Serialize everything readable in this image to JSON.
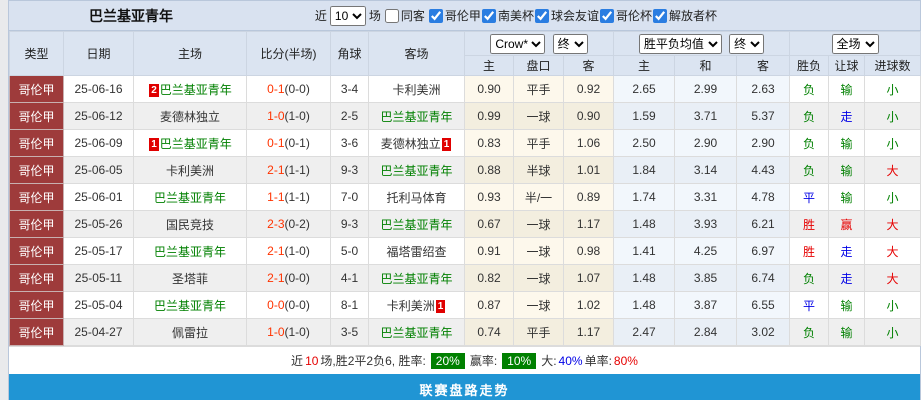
{
  "title": "巴兰基亚青年",
  "filters": {
    "recent_prefix": "近",
    "recent_value": "10",
    "recent_suffix": "场",
    "same_venue_label": "同客",
    "same_venue_checked": false,
    "competitions": [
      {
        "label": "哥伦甲",
        "checked": true
      },
      {
        "label": "南美杯",
        "checked": true
      },
      {
        "label": "球会友谊",
        "checked": true
      },
      {
        "label": "哥伦杯",
        "checked": true
      },
      {
        "label": "解放者杯",
        "checked": true
      }
    ]
  },
  "controls": {
    "bookmaker": "Crow*",
    "ah_time": "终",
    "europe": "胜平负均值",
    "eu_time": "终",
    "scope": "全场"
  },
  "table": {
    "headers": {
      "type": "类型",
      "date": "日期",
      "home": "主场",
      "score": "比分(半场)",
      "corner": "角球",
      "away": "客场",
      "ah_home": "主",
      "ah_line": "盘口",
      "ah_away": "客",
      "eu_home": "主",
      "eu_draw": "和",
      "eu_away": "客",
      "result": "胜负",
      "handicap": "让球",
      "goals": "进球数"
    },
    "rows": [
      {
        "type": "哥伦甲",
        "date": "25-06-16",
        "home": "巴兰基亚青年",
        "home_badge": "2",
        "home_self": true,
        "score": "0-1",
        "half": "(0-0)",
        "corner": "3-4",
        "away": "卡利美洲",
        "away_badge": null,
        "away_self": false,
        "ah_home": "0.90",
        "ah_line": "平手",
        "ah_away": "0.92",
        "eu_home": "2.65",
        "eu_draw": "2.99",
        "eu_away": "2.63",
        "result": "负",
        "handicap": "输",
        "goals": "小"
      },
      {
        "type": "哥伦甲",
        "date": "25-06-12",
        "home": "麦德林独立",
        "home_badge": null,
        "home_self": false,
        "score": "1-0",
        "half": "(1-0)",
        "corner": "2-5",
        "away": "巴兰基亚青年",
        "away_badge": null,
        "away_self": true,
        "ah_home": "0.99",
        "ah_line": "一球",
        "ah_away": "0.90",
        "eu_home": "1.59",
        "eu_draw": "3.71",
        "eu_away": "5.37",
        "result": "负",
        "handicap": "走",
        "goals": "小"
      },
      {
        "type": "哥伦甲",
        "date": "25-06-09",
        "home": "巴兰基亚青年",
        "home_badge": "1",
        "home_self": true,
        "score": "0-1",
        "half": "(0-1)",
        "corner": "3-6",
        "away": "麦德林独立",
        "away_badge": "1",
        "away_self": false,
        "ah_home": "0.83",
        "ah_line": "平手",
        "ah_away": "1.06",
        "eu_home": "2.50",
        "eu_draw": "2.90",
        "eu_away": "2.90",
        "result": "负",
        "handicap": "输",
        "goals": "小"
      },
      {
        "type": "哥伦甲",
        "date": "25-06-05",
        "home": "卡利美洲",
        "home_badge": null,
        "home_self": false,
        "score": "2-1",
        "half": "(1-1)",
        "corner": "9-3",
        "away": "巴兰基亚青年",
        "away_badge": null,
        "away_self": true,
        "ah_home": "0.88",
        "ah_line": "半球",
        "ah_away": "1.01",
        "eu_home": "1.84",
        "eu_draw": "3.14",
        "eu_away": "4.43",
        "result": "负",
        "handicap": "输",
        "goals": "大"
      },
      {
        "type": "哥伦甲",
        "date": "25-06-01",
        "home": "巴兰基亚青年",
        "home_badge": null,
        "home_self": true,
        "score": "1-1",
        "half": "(1-1)",
        "corner": "7-0",
        "away": "托利马体育",
        "away_badge": null,
        "away_self": false,
        "ah_home": "0.93",
        "ah_line": "半/一",
        "ah_away": "0.89",
        "eu_home": "1.74",
        "eu_draw": "3.31",
        "eu_away": "4.78",
        "result": "平",
        "handicap": "输",
        "goals": "小"
      },
      {
        "type": "哥伦甲",
        "date": "25-05-26",
        "home": "国民竞技",
        "home_badge": null,
        "home_self": false,
        "score": "2-3",
        "half": "(0-2)",
        "corner": "9-3",
        "away": "巴兰基亚青年",
        "away_badge": null,
        "away_self": true,
        "ah_home": "0.67",
        "ah_line": "一球",
        "ah_away": "1.17",
        "eu_home": "1.48",
        "eu_draw": "3.93",
        "eu_away": "6.21",
        "result": "胜",
        "handicap": "赢",
        "goals": "大"
      },
      {
        "type": "哥伦甲",
        "date": "25-05-17",
        "home": "巴兰基亚青年",
        "home_badge": null,
        "home_self": true,
        "score": "2-1",
        "half": "(1-0)",
        "corner": "5-0",
        "away": "福塔雷绍查",
        "away_badge": null,
        "away_self": false,
        "ah_home": "0.91",
        "ah_line": "一球",
        "ah_away": "0.98",
        "eu_home": "1.41",
        "eu_draw": "4.25",
        "eu_away": "6.97",
        "result": "胜",
        "handicap": "走",
        "goals": "大"
      },
      {
        "type": "哥伦甲",
        "date": "25-05-11",
        "home": "圣塔菲",
        "home_badge": null,
        "home_self": false,
        "score": "2-1",
        "half": "(0-0)",
        "corner": "4-1",
        "away": "巴兰基亚青年",
        "away_badge": null,
        "away_self": true,
        "ah_home": "0.82",
        "ah_line": "一球",
        "ah_away": "1.07",
        "eu_home": "1.48",
        "eu_draw": "3.85",
        "eu_away": "6.74",
        "result": "负",
        "handicap": "走",
        "goals": "大"
      },
      {
        "type": "哥伦甲",
        "date": "25-05-04",
        "home": "巴兰基亚青年",
        "home_badge": null,
        "home_self": true,
        "score": "0-0",
        "half": "(0-0)",
        "corner": "8-1",
        "away": "卡利美洲",
        "away_badge": "1",
        "away_self": false,
        "ah_home": "0.87",
        "ah_line": "一球",
        "ah_away": "1.02",
        "eu_home": "1.48",
        "eu_draw": "3.87",
        "eu_away": "6.55",
        "result": "平",
        "handicap": "输",
        "goals": "小"
      },
      {
        "type": "哥伦甲",
        "date": "25-04-27",
        "home": "佩雷拉",
        "home_badge": null,
        "home_self": false,
        "score": "1-0",
        "half": "(1-0)",
        "corner": "3-5",
        "away": "巴兰基亚青年",
        "away_badge": null,
        "away_self": true,
        "ah_home": "0.74",
        "ah_line": "平手",
        "ah_away": "1.17",
        "eu_home": "2.47",
        "eu_draw": "2.84",
        "eu_away": "3.02",
        "result": "负",
        "handicap": "输",
        "goals": "小"
      }
    ]
  },
  "summary": {
    "segments": [
      {
        "text": "近",
        "style": "plain"
      },
      {
        "text": "10",
        "style": "red"
      },
      {
        "text": "场,胜2平2负6, 胜率:",
        "style": "plain"
      },
      {
        "text": "20%",
        "style": "badge"
      },
      {
        "text": "赢率:",
        "style": "plain"
      },
      {
        "text": "10%",
        "style": "badge"
      },
      {
        "text": "大:",
        "style": "plain"
      },
      {
        "text": "40%",
        "style": "blue"
      },
      {
        "text": "单率:",
        "style": "plain"
      },
      {
        "text": "80%",
        "style": "red"
      }
    ]
  },
  "footer": {
    "label": "联赛盘路走势"
  },
  "colors": {
    "league_red": "#9e3b3b",
    "team_green": "#008000",
    "score_red": "#ff3300",
    "win_red": "#e60000",
    "draw_blue": "#0000e6",
    "loss_green": "#008000",
    "badge_red": "#e00000",
    "badge_green": "#008000",
    "footer_blue": "#2095d4"
  }
}
